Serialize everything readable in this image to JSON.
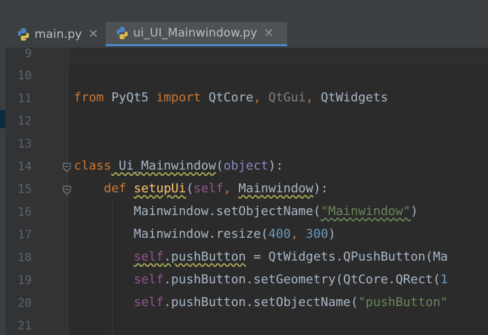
{
  "tabs": [
    {
      "label": "main.py",
      "icon": "python-file-icon"
    },
    {
      "label": "ui_UI_Mainwindow.py",
      "icon": "python-file-icon"
    }
  ],
  "colors": {
    "accent": "#4a88c7",
    "keyword": "#cc7832",
    "function": "#ffc66d",
    "self": "#94558d",
    "number": "#6897bb",
    "string": "#6a8759"
  },
  "editor": {
    "lines": [
      {
        "n": "9"
      },
      {
        "n": "10"
      },
      {
        "n": "11",
        "t": {
          "kw1": "from",
          "mod": " PyQt5 ",
          "kw2": "import",
          "a": " QtCore",
          "c1": ",",
          "b": " QtGui",
          "c2": ",",
          "c": " QtWidgets"
        }
      },
      {
        "n": "12"
      },
      {
        "n": "13"
      },
      {
        "n": "14",
        "t": {
          "kw": "class",
          "name": " Ui_Mainwindow",
          "p1": "(",
          "base": "object",
          "p2": "):"
        }
      },
      {
        "n": "15",
        "t": {
          "ind": "    ",
          "kw": "def",
          "sp": " ",
          "fn": "setupUi",
          "p1": "(",
          "self": "self",
          "c": ", ",
          "arg": "Mainwindow",
          "p2": "):"
        }
      },
      {
        "n": "16",
        "t": {
          "ind": "        ",
          "a": "Mainwindow.setObjectName(",
          "s": "\"Mainwindow\"",
          "b": ")"
        }
      },
      {
        "n": "17",
        "t": {
          "ind": "        ",
          "a": "Mainwindow.resize(",
          "n1": "400",
          "c": ", ",
          "n2": "300",
          "b": ")"
        }
      },
      {
        "n": "18",
        "t": {
          "ind": "        ",
          "self": "self",
          "a": ".pushButton",
          "b": " = QtWidgets.QPushButton(Ma"
        }
      },
      {
        "n": "19",
        "t": {
          "ind": "        ",
          "self": "self",
          "a": ".pushButton.setGeometry(QtCore.QRect(",
          "n1": "1"
        }
      },
      {
        "n": "20",
        "t": {
          "ind": "        ",
          "self": "self",
          "a": ".pushButton.setObjectName(",
          "s": "\"pushButton\""
        }
      },
      {
        "n": "21"
      }
    ]
  }
}
